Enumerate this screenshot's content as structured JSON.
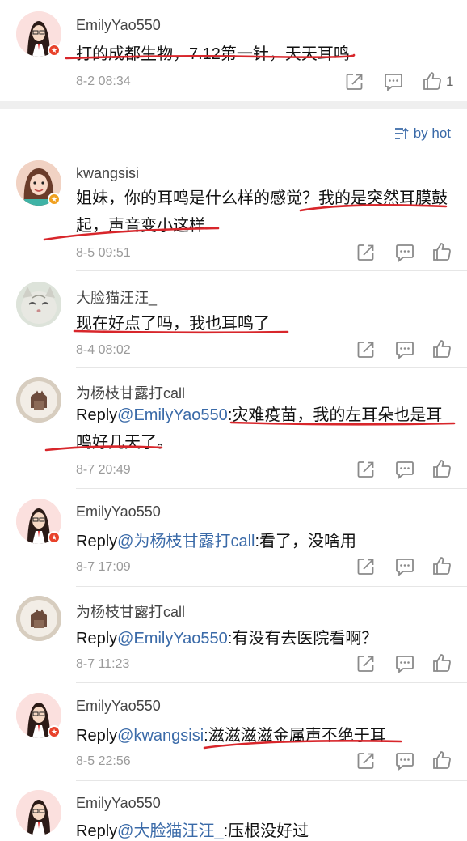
{
  "top_comment": {
    "user": "EmilyYao550",
    "text": "打的成都生物，7.12第一针，天天耳鸣",
    "time": "8-2 08:34",
    "likes": "1"
  },
  "sort": {
    "label": "by hot",
    "icon": "sort-icon"
  },
  "replies": [
    {
      "user": "kwangsisi",
      "text": "姐妹，你的耳鸣是什么样的感觉？我的是突然耳膜鼓起，声音变小这样",
      "time": "8-5 09:51"
    },
    {
      "user": "大脸猫汪汪_",
      "text": "现在好点了吗，我也耳鸣了",
      "time": "8-4 08:02"
    },
    {
      "user": "为杨枝甘露打call",
      "reply_prefix": "Reply",
      "mention": "@EmilyYao550",
      "text": ":灾难疫苗，我的左耳朵也是耳鸣好几天了。",
      "time": "8-7 20:49"
    },
    {
      "user": "EmilyYao550",
      "reply_prefix": "Reply",
      "mention": "@为杨枝甘露打call",
      "text": ":看了，没啥用",
      "time": "8-7 17:09"
    },
    {
      "user": "为杨枝甘露打call",
      "reply_prefix": "Reply",
      "mention": "@EmilyYao550",
      "text": ":有没有去医院看啊？",
      "time": "8-7 11:23"
    },
    {
      "user": "EmilyYao550",
      "reply_prefix": "Reply",
      "mention": "@kwangsisi",
      "text": ":滋滋滋滋金属声不绝于耳",
      "time": "8-5 22:56"
    },
    {
      "user": "EmilyYao550",
      "reply_prefix": "Reply",
      "mention": "@大脸猫汪汪_",
      "text": ":压根没好过"
    }
  ],
  "colors": {
    "mention": "#3a6aa8",
    "underline": "#d8262b",
    "badge": "#e8422b"
  }
}
